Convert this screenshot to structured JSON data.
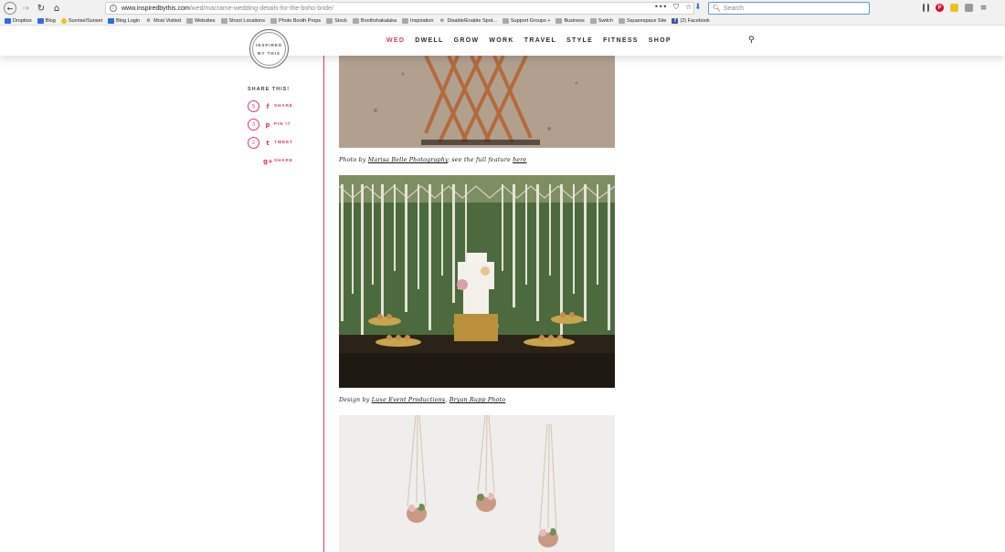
{
  "browser": {
    "url_domain": "www.inspiredbythis.com",
    "url_path": "/wed/macrame-wedding-details-for-the-boho-bride/",
    "search_placeholder": "Search",
    "bookmarks": [
      {
        "label": "Dropbox",
        "icon": "blue"
      },
      {
        "label": "Blog",
        "icon": "blue"
      },
      {
        "label": "Sunrise/Sunset",
        "icon": "star"
      },
      {
        "label": "Blog Login",
        "icon": "blue"
      },
      {
        "label": "Most Visited",
        "icon": "gear"
      },
      {
        "label": "Websites",
        "icon": "folder"
      },
      {
        "label": "Shoot Locations",
        "icon": "folder"
      },
      {
        "label": "Photo Booth Props",
        "icon": "folder"
      },
      {
        "label": "Stock",
        "icon": "folder"
      },
      {
        "label": "Boothshakalaka",
        "icon": "folder"
      },
      {
        "label": "Inspiration",
        "icon": "folder"
      },
      {
        "label": "Disable/Enable Spot...",
        "icon": "gear"
      },
      {
        "label": "Support Groups +",
        "icon": "folder"
      },
      {
        "label": "Business",
        "icon": "folder"
      },
      {
        "label": "Switch",
        "icon": "folder"
      },
      {
        "label": "Squarespace Site",
        "icon": "folder"
      },
      {
        "label": "(2) Facebook",
        "icon": "fb"
      }
    ]
  },
  "site": {
    "logo_top": "INSPIRED",
    "logo_bottom": "BY THIS",
    "accent_color": "#d8396c",
    "nav": [
      {
        "label": "WED",
        "active": true
      },
      {
        "label": "DWELL",
        "active": false
      },
      {
        "label": "GROW",
        "active": false
      },
      {
        "label": "WORK",
        "active": false
      },
      {
        "label": "TRAVEL",
        "active": false
      },
      {
        "label": "STYLE",
        "active": false
      },
      {
        "label": "FITNESS",
        "active": false
      },
      {
        "label": "SHOP",
        "active": false
      }
    ]
  },
  "share": {
    "title": "SHARE THIS!",
    "items": [
      {
        "count": "5",
        "icon": "facebook-icon",
        "glyph": "f",
        "label": "SHARE"
      },
      {
        "count": "3",
        "icon": "pinterest-icon",
        "glyph": "p",
        "label": "PIN IT"
      },
      {
        "count": "2",
        "icon": "twitter-icon",
        "glyph": "t",
        "label": "TWEET"
      },
      {
        "count": "",
        "icon": "google-plus-icon",
        "glyph": "g+",
        "label": "SHARE"
      }
    ]
  },
  "article": {
    "caption1": {
      "prefix": "Photo by ",
      "link1": "Marisa Belle Photography",
      "middle": ", see the full feature ",
      "link2": "here"
    },
    "caption2": {
      "prefix": "Design by ",
      "link1": "Luxe Event Productions",
      "middle": ", ",
      "link2": "Bryan Rupp Photo"
    }
  }
}
